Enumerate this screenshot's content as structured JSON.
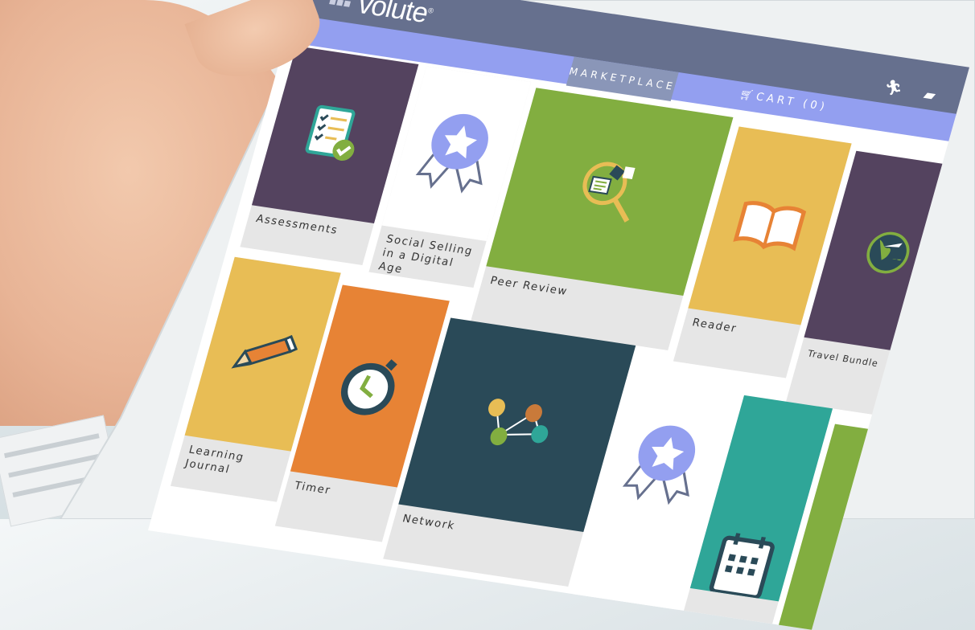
{
  "app": {
    "logo": "volute",
    "logo_mark": "®"
  },
  "header": {
    "tab_marketplace": "MARKETPLACE",
    "cart_label": "CART (0)",
    "icons": [
      "cart-icon",
      "logout-runner-icon",
      "chat-icon"
    ]
  },
  "tiles": [
    {
      "label": "Assessments",
      "color": "#54435f",
      "icon": "checklist-icon"
    },
    {
      "label": "Social Selling in a Digital Age",
      "color": "#ffffff",
      "icon": "award-badge-icon"
    },
    {
      "label": "Peer Review",
      "color": "#82ae40",
      "icon": "magnifier-documents-icon"
    },
    {
      "label": "Reader",
      "color": "#e8bd55",
      "icon": "open-book-icon"
    },
    {
      "label": "Travel Bundle",
      "color": "#54435f",
      "icon": "globe-plane-icon"
    },
    {
      "label": "Learning Journal",
      "color": "#e8bd55",
      "icon": "pencil-icon"
    },
    {
      "label": "Timer",
      "color": "#e78335",
      "icon": "stopwatch-icon"
    },
    {
      "label": "Network",
      "color": "#2a4a58",
      "icon": "network-nodes-icon"
    },
    {
      "label": "",
      "color": "#ffffff",
      "icon": "award-badge-icon"
    },
    {
      "label": "",
      "color": "#2fa698",
      "icon": "calendar-icon"
    },
    {
      "label": "",
      "color": "#82ae40",
      "icon": ""
    }
  ]
}
